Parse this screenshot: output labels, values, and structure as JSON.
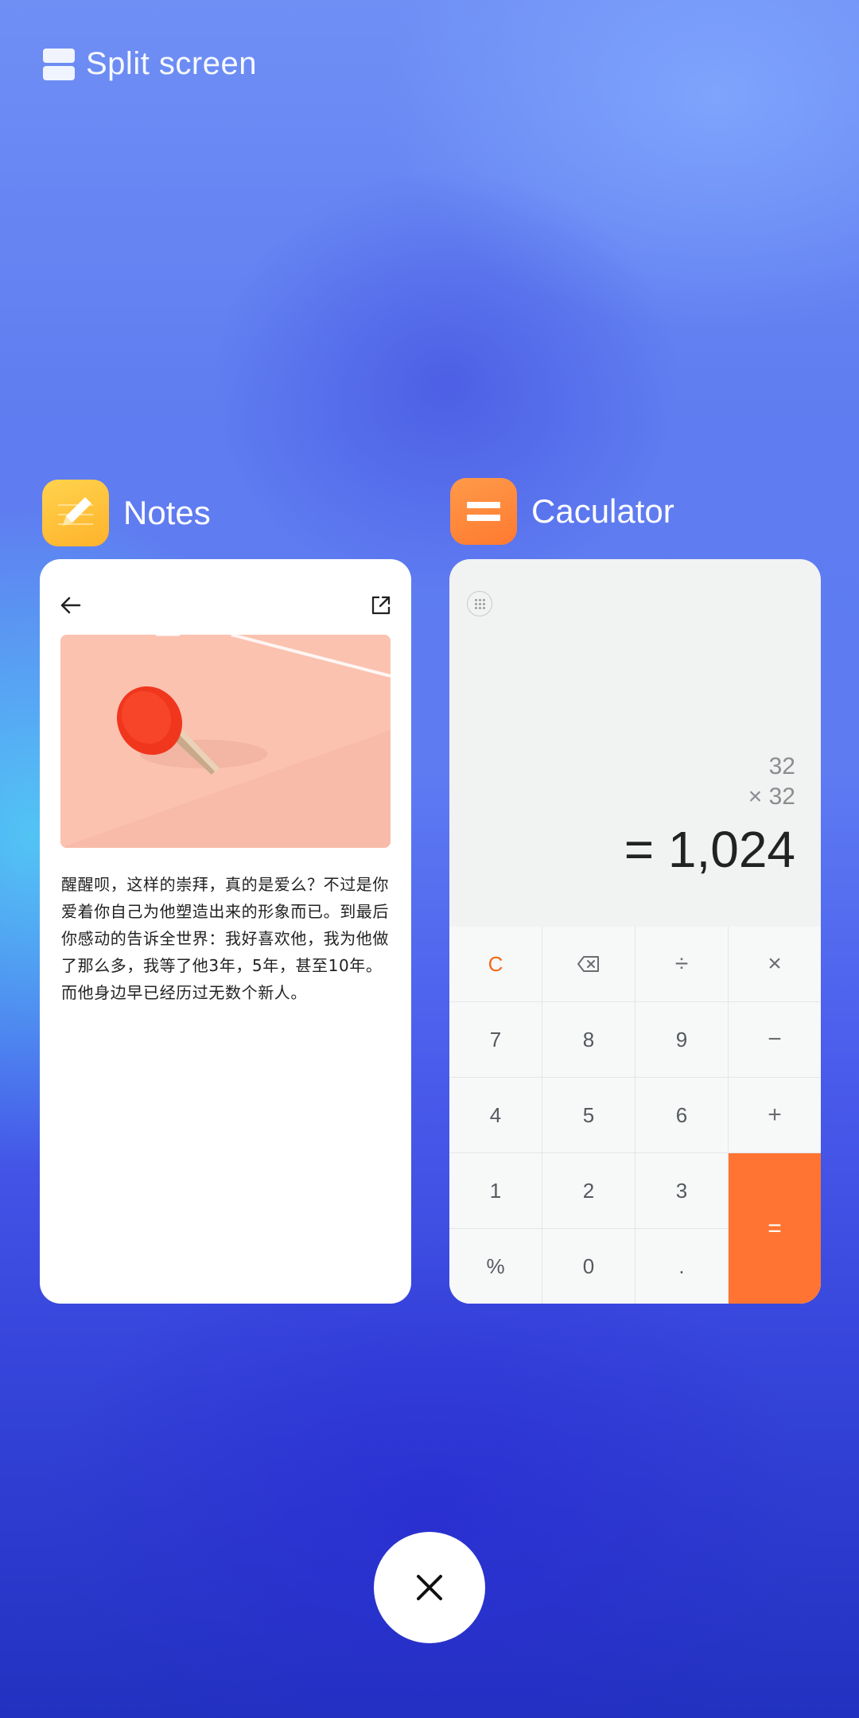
{
  "header": {
    "title": "Split screen",
    "icon": "split-screen-icon"
  },
  "apps": {
    "notes": {
      "name": "Notes",
      "icon": "pencil-icon",
      "icon_color": "#FFC13A"
    },
    "calculator": {
      "name": "Caculator",
      "icon": "equals-icon",
      "icon_color": "#FF8A3D"
    }
  },
  "notes_card": {
    "back_icon": "back-arrow-icon",
    "share_icon": "share-icon",
    "image": "ping-pong-paddle-image",
    "body_text": "醒醒呗，这样的崇拜，真的是爱么？不过是你爱着你自己为他塑造出来的形象而已。到最后你感动的告诉全世界：我好喜欢他，我为他做了那么多，我等了他3年，5年，甚至10年。而他身边早已经历过无数个新人。"
  },
  "calculator_card": {
    "menu_icon": "grid-menu-icon",
    "operand_1": "32",
    "operand_2": "×   32",
    "result": "= 1,024",
    "keys": [
      [
        "C",
        "⌫",
        "÷",
        "×"
      ],
      [
        "7",
        "8",
        "9",
        "−"
      ],
      [
        "4",
        "5",
        "6",
        "+"
      ],
      [
        "1",
        "2",
        "3",
        "="
      ],
      [
        "%",
        "0",
        "."
      ]
    ],
    "accent_color": "#FF7433"
  },
  "close_button": {
    "icon": "close-icon"
  }
}
